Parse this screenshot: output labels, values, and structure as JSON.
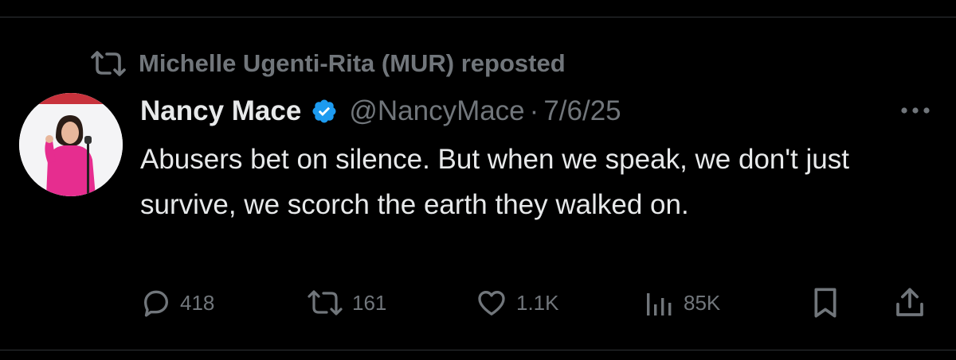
{
  "repost": {
    "icon": "repost-icon",
    "text": "Michelle Ugenti-Rita (MUR) reposted"
  },
  "tweet": {
    "author": {
      "display_name": "Nancy Mace",
      "verified": true,
      "handle": "@NancyMace",
      "avatar": "avatar"
    },
    "separator": "·",
    "date": "7/6/25",
    "text": "Abusers bet on silence. But when we speak, we don't just survive, we scorch the earth they walked on.",
    "more_icon": "more-icon"
  },
  "actions": {
    "replies": "418",
    "reposts": "161",
    "likes": "1.1K",
    "views": "85K",
    "bookmark_icon": "bookmark-icon",
    "share_icon": "share-icon"
  },
  "colors": {
    "background": "#000000",
    "primary_text": "#e7e9ea",
    "secondary_text": "#71767b",
    "verified_blue": "#1d9bf0",
    "divider": "#2f3336"
  }
}
